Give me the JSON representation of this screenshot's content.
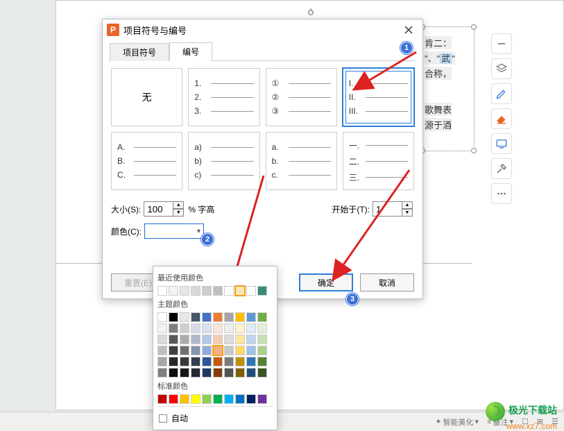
{
  "dialog": {
    "title": "项目符号与编号",
    "tabs": {
      "bullets": "项目符号",
      "numbers": "编号"
    },
    "none_label": "无",
    "styles": {
      "s1": [
        "1.",
        "2.",
        "3."
      ],
      "s2": [
        "①",
        "②",
        "③"
      ],
      "s3": [
        "I.",
        "II.",
        "III."
      ],
      "s4": [
        "A.",
        "B.",
        "C."
      ],
      "s5": [
        "a)",
        "b)",
        "c)"
      ],
      "s6": [
        "a.",
        "b.",
        "c."
      ],
      "s7": [
        "一.",
        "二.",
        "三."
      ]
    },
    "size_label": "大小(S):",
    "size_value": "100",
    "size_unit": "% 字高",
    "start_label": "开始于(T):",
    "start_value": "1",
    "color_label": "颜色(C):",
    "reset_label": "重置(E)",
    "ok_label": "确定",
    "cancel_label": "取消"
  },
  "badges": {
    "b1": "1",
    "b2": "2",
    "b3": "3"
  },
  "color_picker": {
    "recent_label": "最近使用颜色",
    "theme_label": "主题颜色",
    "standard_label": "标准颜色",
    "auto_label": "自动",
    "recent": [
      "#ffffff",
      "#f2f2f2",
      "#e6e6e6",
      "#d9d9d9",
      "#cccccc",
      "#bfbfbf",
      "#ffffff",
      "#f9e7b5",
      "#ffffff",
      "#3a8b7a"
    ],
    "theme_row": [
      "#ffffff",
      "#000000",
      "#e7e6e6",
      "#44546a",
      "#4472c4",
      "#ed7d31",
      "#a5a5a5",
      "#ffc000",
      "#5b9bd5",
      "#70ad47"
    ],
    "theme_shades": [
      [
        "#f2f2f2",
        "#7f7f7f",
        "#d0cece",
        "#d6dce5",
        "#d9e2f3",
        "#fbe5d6",
        "#ededed",
        "#fff2cc",
        "#deebf7",
        "#e2f0d9"
      ],
      [
        "#d9d9d9",
        "#595959",
        "#aeabab",
        "#adb9ca",
        "#b4c7e7",
        "#f7cbac",
        "#dbdbdb",
        "#ffe699",
        "#bdd7ee",
        "#c5e0b4"
      ],
      [
        "#bfbfbf",
        "#3f3f3f",
        "#757070",
        "#8496b0",
        "#8faadc",
        "#f4b183",
        "#c9c9c9",
        "#ffd966",
        "#9dc3e6",
        "#a9d18e"
      ],
      [
        "#a6a6a6",
        "#262626",
        "#3a3838",
        "#323f4f",
        "#2f5597",
        "#c55a11",
        "#7b7b7b",
        "#bf9000",
        "#2e75b6",
        "#548235"
      ],
      [
        "#7f7f7f",
        "#0d0d0d",
        "#171616",
        "#222a35",
        "#1f3864",
        "#833c0c",
        "#525252",
        "#7f6000",
        "#1f4e79",
        "#385723"
      ]
    ],
    "standard": [
      "#c00000",
      "#ff0000",
      "#ffc000",
      "#ffff00",
      "#92d050",
      "#00b050",
      "#00b0f0",
      "#0070c0",
      "#002060",
      "#7030a0"
    ]
  },
  "side_tools": {
    "minus": "minus-icon",
    "layers": "layers-icon",
    "pen": "pen-icon",
    "eraser": "eraser-icon",
    "monitor": "monitor-icon",
    "tools": "tools-icon",
    "more": "more-icon"
  },
  "bg_text": {
    "t1": "肯二：",
    "t2": "\"、\"",
    "t2b": "武",
    "t3": "合称，",
    "t4": "歌舞表",
    "t5": "源于酒"
  },
  "status": {
    "smart": "智能美化",
    "notes": "备注"
  },
  "watermark": {
    "line1": "极光下载站",
    "line2": "www.xz7.com"
  }
}
